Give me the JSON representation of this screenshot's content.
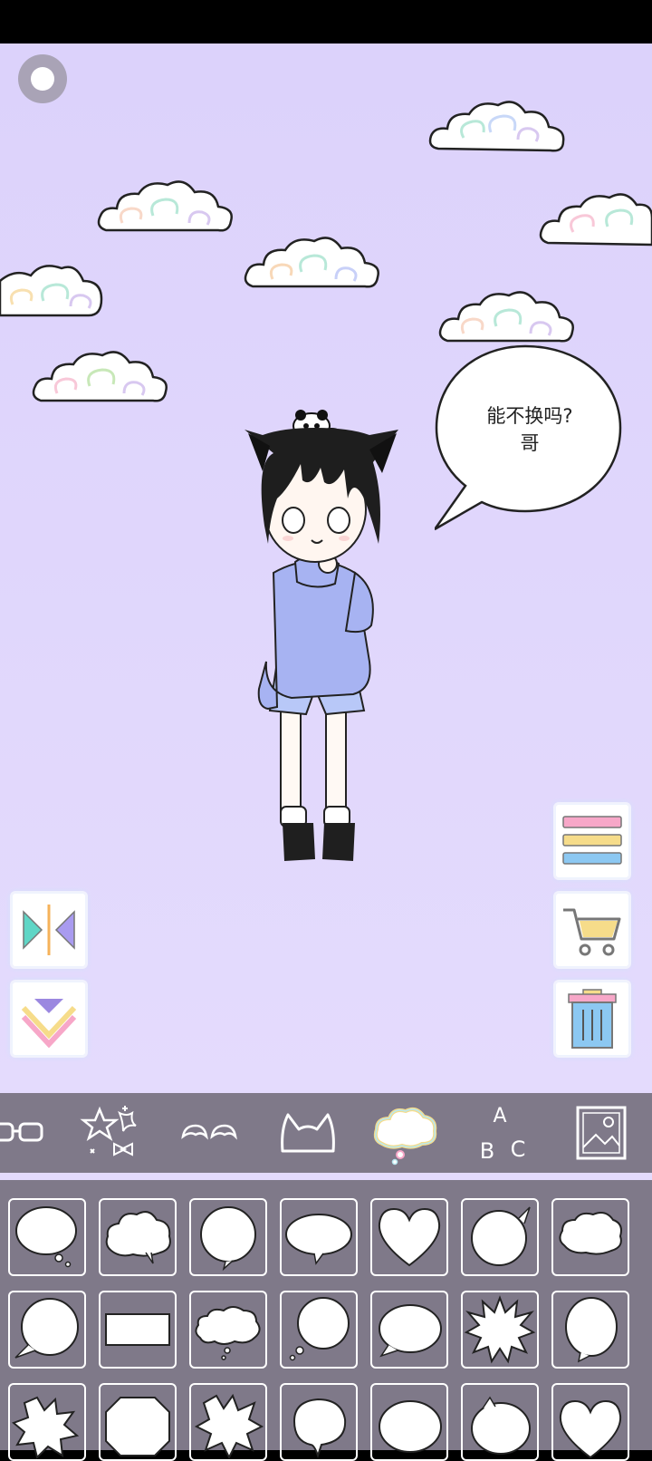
{
  "speech_bubble": {
    "line1": "能不换吗?",
    "line2": "哥"
  },
  "icons": {
    "record": "record-icon",
    "menu": "menu-lines-icon",
    "cart": "shopping-cart-icon",
    "trash": "trash-can-icon",
    "flip": "flip-horizontal-icon",
    "layer_down": "layer-down-icon"
  },
  "categories": [
    {
      "name": "glasses-icon",
      "selected": false
    },
    {
      "name": "sparkles-icon",
      "selected": false
    },
    {
      "name": "wings-icon",
      "selected": false
    },
    {
      "name": "cat-ears-icon",
      "selected": false
    },
    {
      "name": "speech-cloud-icon",
      "selected": true
    },
    {
      "name": "text-abc-icon",
      "selected": false,
      "labels": [
        "A",
        "B",
        "C"
      ]
    },
    {
      "name": "background-image-icon",
      "selected": false
    }
  ],
  "bubble_shapes": [
    "thought-round",
    "cloud",
    "round",
    "oval",
    "heart",
    "round-tail",
    "cloud-small",
    "round-tail-left",
    "rectangle",
    "cloud-wide",
    "thought-dots",
    "oval-tail",
    "burst",
    "oval-tall",
    "burst-2",
    "octagon",
    "burst-3",
    "round-2",
    "oval-2",
    "round-3",
    "heart-2"
  ],
  "colors": {
    "stage_bg": "#ded4fc",
    "toolbar_bg": "#7f7989",
    "hoodie": "#a7b3f2",
    "hair": "#1e1e1e",
    "menu_pink": "#f7a7c8",
    "menu_yellow": "#f6dc8a",
    "menu_blue": "#8cc8f2"
  }
}
